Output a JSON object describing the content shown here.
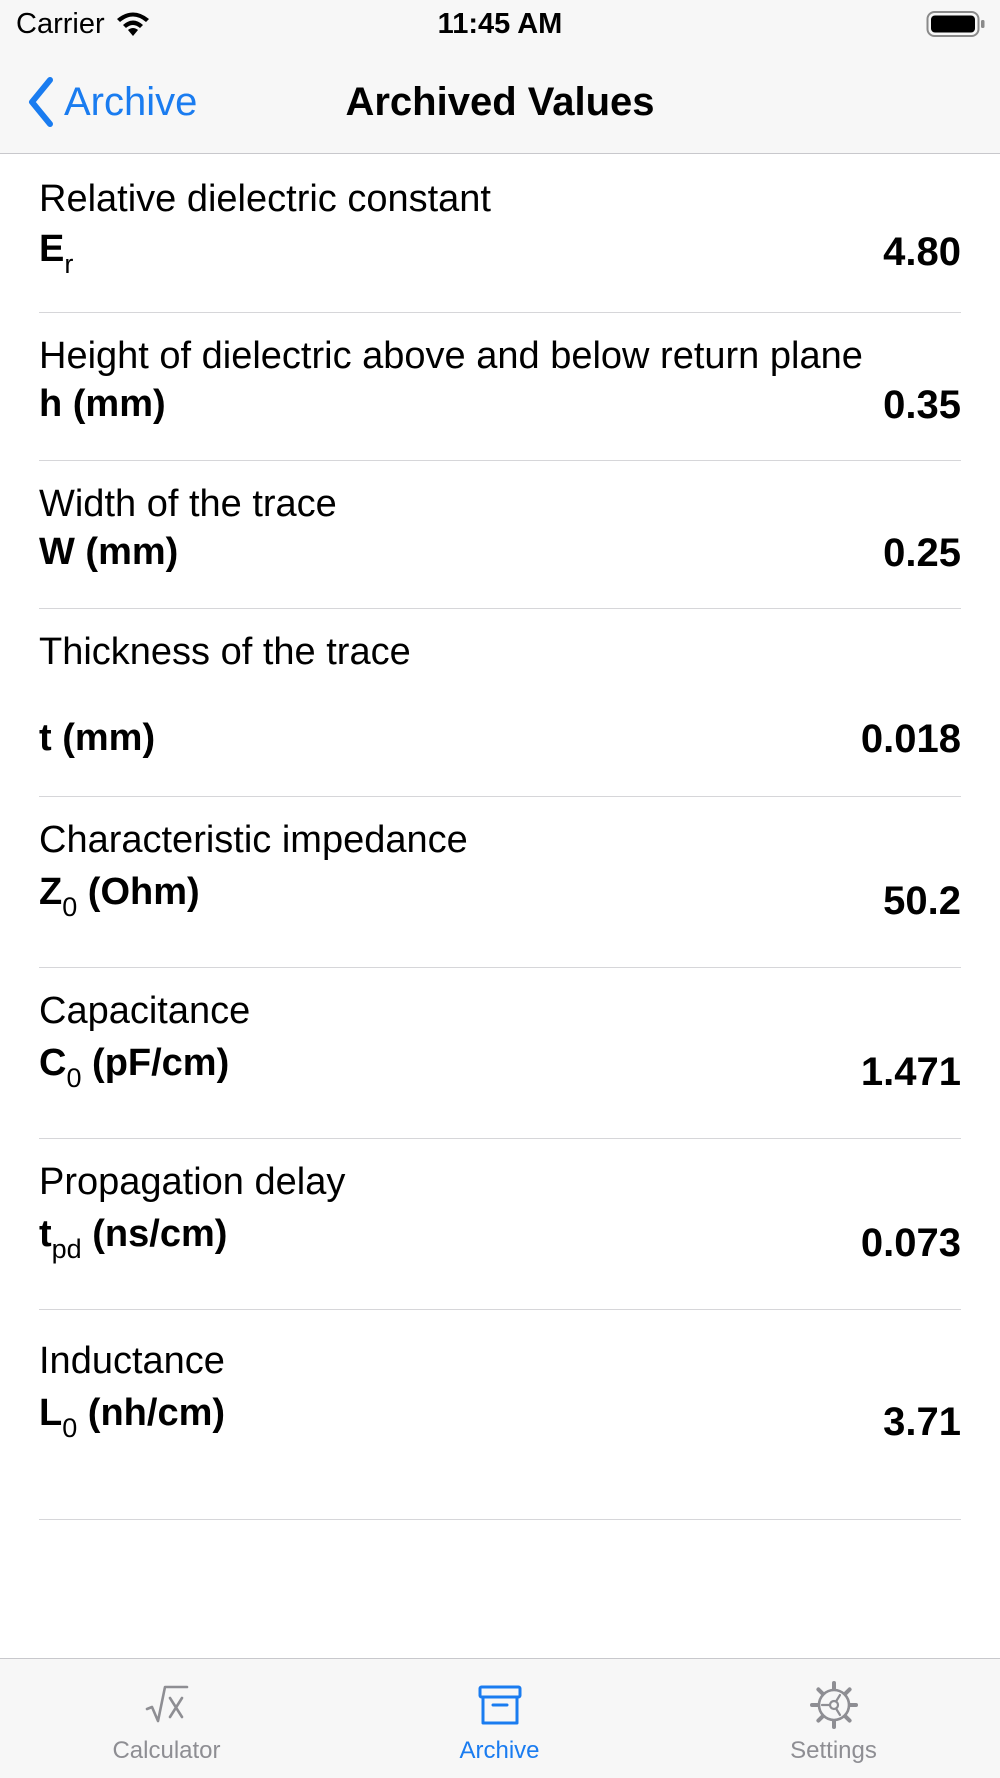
{
  "status_bar": {
    "carrier": "Carrier",
    "time": "11:45 AM",
    "icons": [
      "wifi-icon",
      "battery-icon"
    ]
  },
  "nav_bar": {
    "back_label": "Archive",
    "title": "Archived Values",
    "accent_color": "#1a7cf0"
  },
  "rows": [
    {
      "description": "Relative dielectric constant",
      "symbol_main": "E",
      "symbol_sub": "r",
      "symbol_rest": "",
      "value": "4.80"
    },
    {
      "description": "Height of dielectric above and below return plane",
      "symbol_main": "h (mm)",
      "symbol_sub": "",
      "symbol_rest": "",
      "value": "0.35"
    },
    {
      "description": "Width of the trace",
      "symbol_main": "W (mm)",
      "symbol_sub": "",
      "symbol_rest": "",
      "value": "0.25"
    },
    {
      "description": "Thickness of the trace",
      "symbol_main": "t (mm)",
      "symbol_sub": "",
      "symbol_rest": "",
      "value": "0.018"
    },
    {
      "description": "Characteristic impedance",
      "symbol_main": "Z",
      "symbol_sub": "0",
      "symbol_rest": " (Ohm)",
      "value": "50.2"
    },
    {
      "description": "Capacitance",
      "symbol_main": "C",
      "symbol_sub": "0",
      "symbol_rest": " (pF/cm)",
      "value": "1.471"
    },
    {
      "description": "Propagation delay",
      "symbol_main": "t",
      "symbol_sub": "pd",
      "symbol_rest": " (ns/cm)",
      "value": "0.073"
    },
    {
      "description": "Inductance",
      "symbol_main": "L",
      "symbol_sub": "0",
      "symbol_rest": " (nh/cm)",
      "value": "3.71"
    }
  ],
  "tab_bar": {
    "tabs": [
      {
        "label": "Calculator",
        "icon": "square-root-icon",
        "active": false
      },
      {
        "label": "Archive",
        "icon": "archive-box-icon",
        "active": true
      },
      {
        "label": "Settings",
        "icon": "gear-icon",
        "active": false
      }
    ],
    "active_color": "#1a7cf0",
    "inactive_color": "#8e8e93"
  }
}
